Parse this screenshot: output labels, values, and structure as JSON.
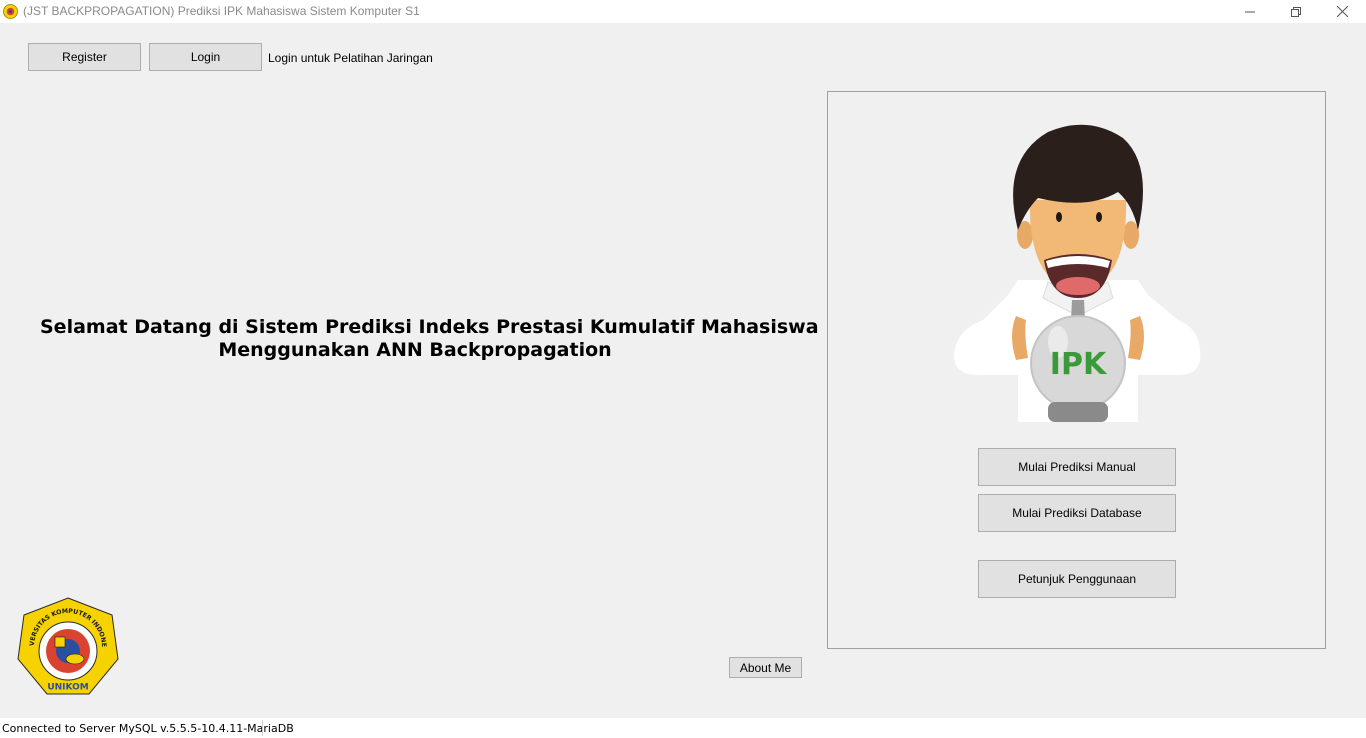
{
  "window": {
    "title": "(JST BACKPROPAGATION) Prediksi IPK Mahasiswa Sistem Komputer S1",
    "controls": [
      "minimize-icon",
      "restore-icon",
      "close-icon"
    ]
  },
  "toolbar": {
    "register_label": "Register",
    "login_label": "Login",
    "login_hint": "Login untuk Pelatihan Jaringan"
  },
  "main": {
    "welcome_line1": "Selamat Datang di Sistem Prediksi Indeks Prestasi Kumulatif Mahasiswa",
    "welcome_line2": "Menggunakan ANN Backpropagation",
    "about_label": "About Me"
  },
  "panel": {
    "illustration_text": "IPK",
    "buttons": {
      "manual": "Mulai Prediksi Manual",
      "database": "Mulai Prediksi Database",
      "guide": "Petunjuk Penggunaan"
    }
  },
  "logo": {
    "arc_text": "UNIVERSITAS KOMPUTER INDONESIA",
    "name": "UNIKOM"
  },
  "status": {
    "text": "Connected to Server MySQL v.5.5.5-10.4.11-MariaDB"
  },
  "colors": {
    "window_bg": "#f0f0f0",
    "button_bg": "#e1e1e1",
    "button_border": "#adadad",
    "logo_yellow": "#f5d200",
    "ipk_green": "#3a9a3a"
  }
}
